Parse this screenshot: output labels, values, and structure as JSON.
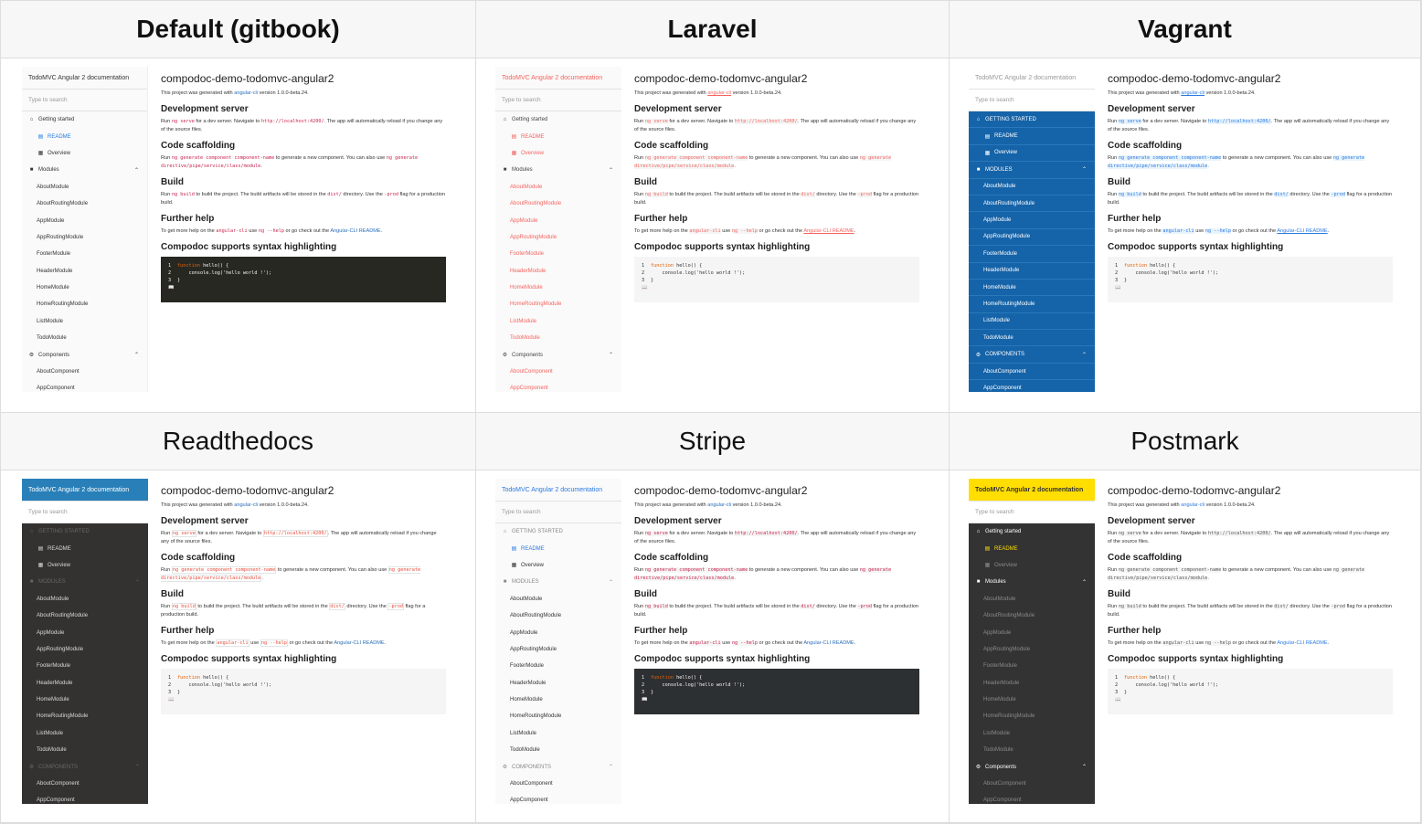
{
  "headers": [
    "Default (gitbook)",
    "Laravel",
    "Vagrant",
    "Readthedocs",
    "Stripe",
    "Postmark"
  ],
  "doc": {
    "title": "compodoc-demo-todomvc-angular2",
    "intro_prefix": "This project was generated with ",
    "intro_link": "angular-cli",
    "intro_suffix": " version 1.0.0-beta.24.",
    "dev_heading": "Development server",
    "dev_prefix": "Run ",
    "dev_code1": "ng serve",
    "dev_mid": " for a dev server. Navigate to ",
    "dev_code2": "http://localhost:4200/",
    "dev_suffix": ". The app will automatically reload if you change any of the source files.",
    "scaffold_heading": "Code scaffolding",
    "scaffold_prefix": "Run ",
    "scaffold_code1": "ng generate component component-name",
    "scaffold_mid": " to generate a new component. You can also use ",
    "scaffold_code2": "ng generate directive/pipe/service/class/module",
    "scaffold_suffix": ".",
    "build_heading": "Build",
    "build_prefix": "Run ",
    "build_code1": "ng build",
    "build_mid": " to build the project. The build artifacts will be stored in the ",
    "build_code2": "dist/",
    "build_mid2": " directory. Use the ",
    "build_code3": "-prod",
    "build_suffix": " flag for a production build.",
    "help_heading": "Further help",
    "help_prefix": "To get more help on the ",
    "help_code1": "angular-cli",
    "help_mid": " use ",
    "help_code2": "ng --help",
    "help_mid2": " or go check out the ",
    "help_link": "Angular-CLI README",
    "help_suffix": ".",
    "syntax_heading": "Compodoc supports syntax highlighting",
    "code_lines": [
      {
        "n": "1",
        "kw": "function",
        "rest": " hello() {"
      },
      {
        "n": "2",
        "kw": "",
        "rest": "    console.log('hello world !');"
      },
      {
        "n": "3",
        "kw": "",
        "rest": "}"
      }
    ]
  },
  "sidebar": {
    "title": "TodoMVC Angular 2 documentation",
    "search_placeholder": "Type to search",
    "getting_started": "Getting started",
    "readme": "README",
    "overview": "Overview",
    "modules": "Modules",
    "module_items": [
      "AboutModule",
      "AboutRoutingModule",
      "AppModule",
      "AppRoutingModule",
      "FooterModule",
      "HeaderModule",
      "HomeModule",
      "HomeRoutingModule",
      "ListModule",
      "TodoModule"
    ],
    "components": "Components",
    "component_items": [
      "AboutComponent",
      "AppComponent"
    ]
  }
}
